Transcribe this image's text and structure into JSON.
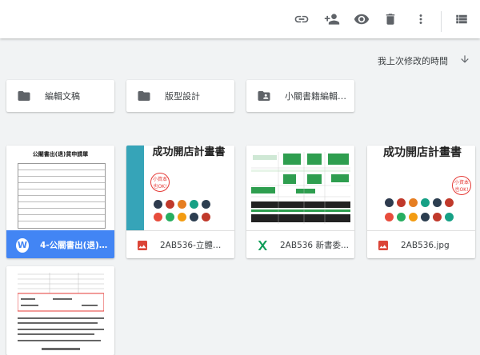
{
  "toolbar": {
    "icons": [
      "link-icon",
      "add-person-icon",
      "preview-eye-icon",
      "trash-icon",
      "more-vert-icon",
      "list-view-icon"
    ]
  },
  "sort": {
    "label": "我上次修改的時間",
    "direction_icon": "arrow-down-icon"
  },
  "folders": [
    {
      "name": "編輯文稿",
      "icon": "folder-icon"
    },
    {
      "name": "版型設計",
      "icon": "folder-icon"
    },
    {
      "name": "小關書籍編輯專...",
      "icon": "shared-folder-icon"
    }
  ],
  "files": [
    {
      "name": "4-公關書出(退)貨...",
      "type": "word",
      "type_glyph": "W",
      "selected": true,
      "thumb_title": "公關書出(退)貨申請單"
    },
    {
      "name": "2AB536-立體書.j...",
      "type": "image",
      "thumb_title": "成功開店計畫書",
      "thumb_badge": "小資本也OK!"
    },
    {
      "name": "2AB536 新書委...",
      "type": "sheet"
    },
    {
      "name": "2AB536.jpg",
      "type": "image",
      "thumb_title": "成功開店計畫書",
      "thumb_badge": "小資本也OK!"
    },
    {
      "name": "",
      "type": "doc"
    }
  ],
  "colors": {
    "accent": "#4285f4",
    "image_red": "#db4437",
    "sheet_green": "#0f9d58",
    "book_teal": "#36a4b8"
  }
}
